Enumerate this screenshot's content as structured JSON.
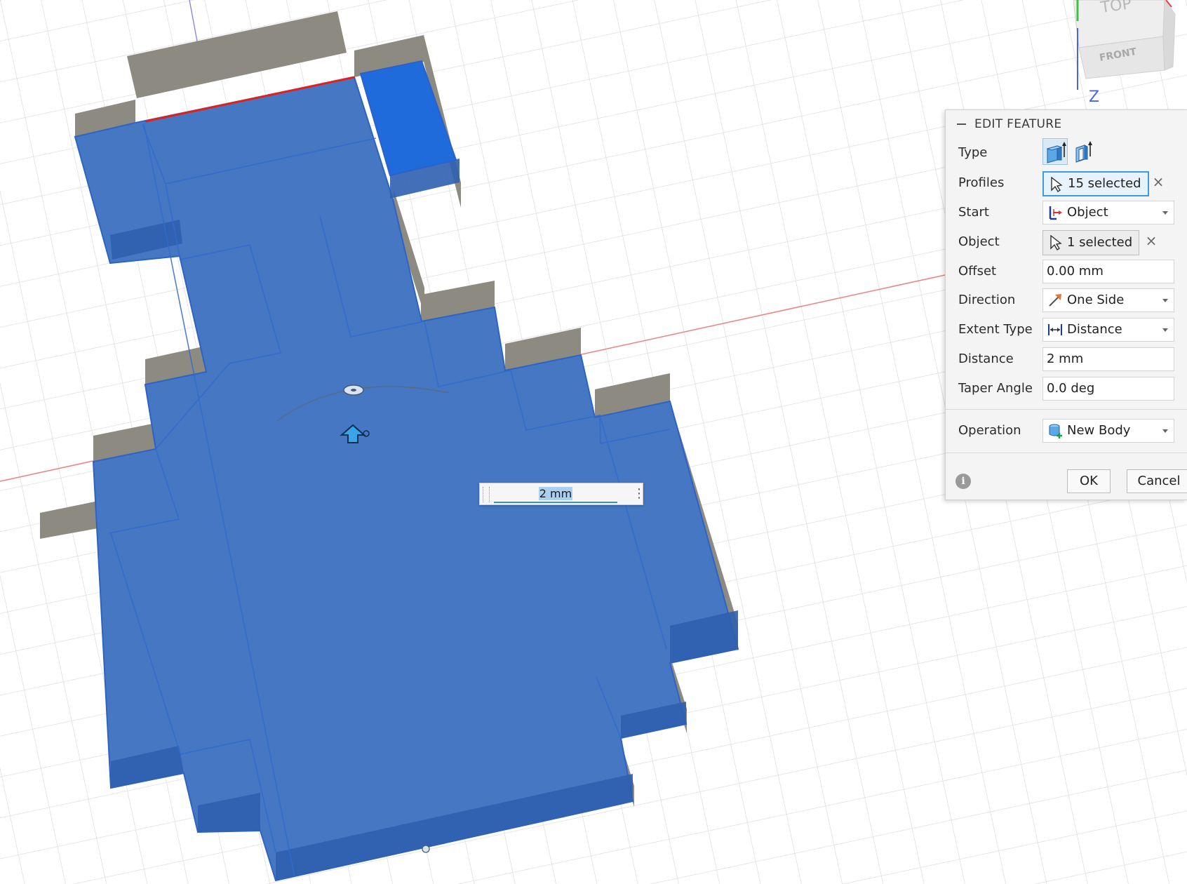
{
  "viewcube": {
    "top_label": "TOP",
    "front_label": "FRONT",
    "axis_label": "Z"
  },
  "canvas": {
    "distance_input": "2 mm"
  },
  "panel": {
    "title": "EDIT FEATURE",
    "rows": {
      "type": {
        "label": "Type"
      },
      "profiles": {
        "label": "Profiles",
        "value": "15 selected"
      },
      "start": {
        "label": "Start",
        "value": "Object"
      },
      "object": {
        "label": "Object",
        "value": "1 selected"
      },
      "offset": {
        "label": "Offset",
        "value": "0.00 mm"
      },
      "direction": {
        "label": "Direction",
        "value": "One Side"
      },
      "extent_type": {
        "label": "Extent Type",
        "value": "Distance"
      },
      "distance": {
        "label": "Distance",
        "value": "2 mm"
      },
      "taper_angle": {
        "label": "Taper Angle",
        "value": "0.0 deg"
      },
      "operation": {
        "label": "Operation",
        "value": "New Body"
      }
    },
    "ok_label": "OK",
    "cancel_label": "Cancel",
    "clear_symbol": "×",
    "info_symbol": "i"
  },
  "colors": {
    "body_blue": "#4577c2",
    "edge_blue": "#2a62c9",
    "wall_gray": "#8d8a82",
    "grid": "#d6d6d6",
    "axis_red": "#f07a7a",
    "accent": "#3d9be0"
  }
}
